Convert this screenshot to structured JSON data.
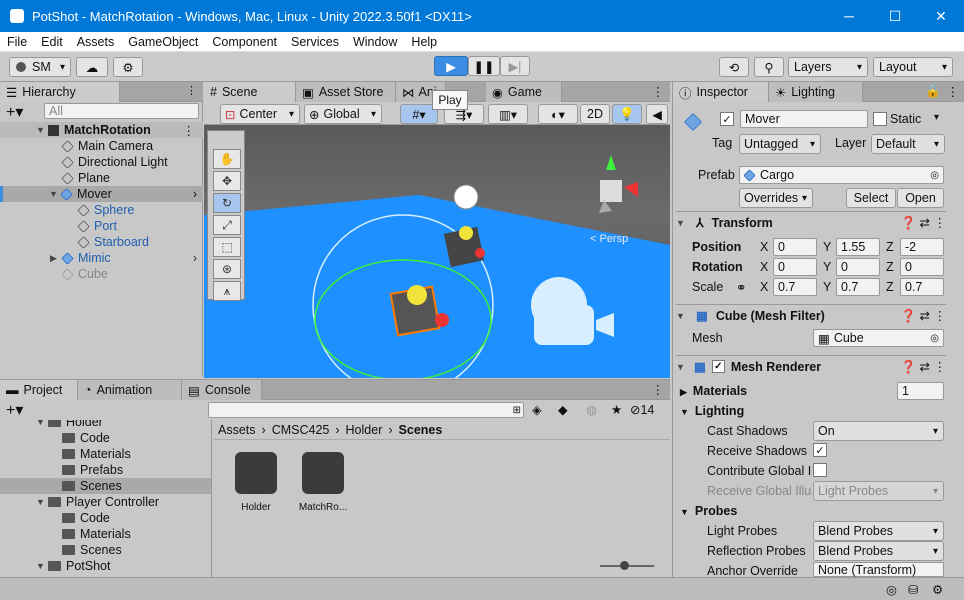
{
  "window": {
    "title": "PotShot - MatchRotation - Windows, Mac, Linux - Unity 2022.3.50f1 <DX11>",
    "min": "─",
    "max": "☐",
    "close": "✕"
  },
  "menu": [
    "File",
    "Edit",
    "Assets",
    "GameObject",
    "Component",
    "Services",
    "Window",
    "Help"
  ],
  "toolbar": {
    "account": "SM",
    "play_tooltip": "Play",
    "layers": "Layers",
    "layout": "Layout"
  },
  "hierarchy": {
    "tab": "Hierarchy",
    "search_placeholder": "All",
    "scene": "MatchRotation",
    "items": [
      "Main Camera",
      "Directional Light",
      "Plane",
      "Mover",
      "Sphere",
      "Port",
      "Starboard",
      "Mimic",
      "Cube"
    ]
  },
  "scene_tabs": [
    "Scene",
    "Asset Store",
    "Ani",
    "Game"
  ],
  "scene_toolbar": {
    "pivot": "Center",
    "space": "Global",
    "mode2d": "2D"
  },
  "scene_view": {
    "persp": "< Persp"
  },
  "inspector": {
    "tab": "Inspector",
    "tab2": "Lighting",
    "name": "Mover",
    "static": "Static",
    "tag_label": "Tag",
    "tag": "Untagged",
    "layer_label": "Layer",
    "layer": "Default",
    "prefab_label": "Prefab",
    "prefab": "Cargo",
    "overrides": "Overrides",
    "select": "Select",
    "open": "Open",
    "transform": {
      "title": "Transform",
      "position_label": "Position",
      "rotation_label": "Rotation",
      "scale_label": "Scale",
      "position": [
        "0",
        "1.55",
        "-2"
      ],
      "rotation": [
        "0",
        "0",
        "0"
      ],
      "scale": [
        "0.7",
        "0.7",
        "0.7"
      ],
      "axes": [
        "X",
        "Y",
        "Z"
      ]
    },
    "mesh_filter": {
      "title": "Cube (Mesh Filter)",
      "mesh_label": "Mesh",
      "mesh": "Cube"
    },
    "mesh_renderer": {
      "title": "Mesh Renderer",
      "materials_label": "Materials",
      "materials_count": "1",
      "lighting": "Lighting",
      "cast_shadows_label": "Cast Shadows",
      "cast_shadows": "On",
      "receive_shadows": "Receive Shadows",
      "contribute_gi": "Contribute Global I",
      "receive_gi": "Receive Global Illu",
      "receive_gi_value": "Light Probes",
      "probes": "Probes",
      "light_probes_label": "Light Probes",
      "light_probes": "Blend Probes",
      "reflection_label": "Reflection Probes",
      "reflection": "Blend Probes",
      "anchor_label": "Anchor Override",
      "anchor": "None (Transform)"
    }
  },
  "project": {
    "tabs": [
      "Project",
      "Animation",
      "Console"
    ],
    "count": "14",
    "breadcrumb": [
      "Assets",
      "CMSC425",
      "Holder",
      "Scenes"
    ],
    "tree": [
      "Holder",
      "Code",
      "Materials",
      "Prefabs",
      "Scenes",
      "Player Controller",
      "Code",
      "Materials",
      "Scenes",
      "PotShot"
    ],
    "assets": [
      "Holder",
      "MatchRo..."
    ]
  }
}
